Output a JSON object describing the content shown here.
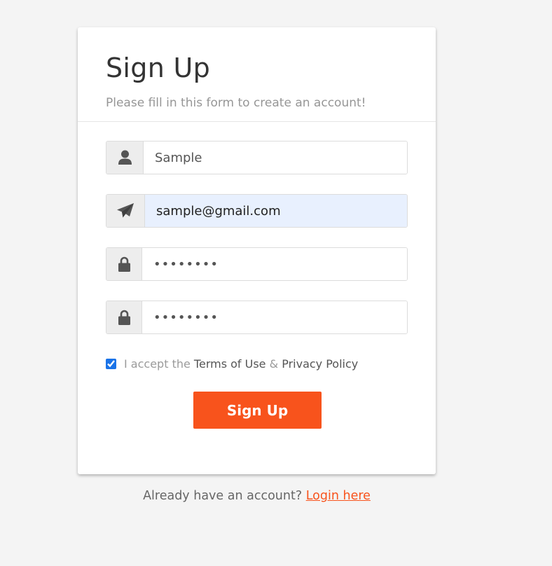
{
  "form": {
    "title": "Sign Up",
    "subtitle": "Please fill in this form to create an account!",
    "fields": {
      "username": {
        "value": "Sample",
        "icon": "user-icon"
      },
      "email": {
        "value": "sample@gmail.com",
        "icon": "paper-plane-icon"
      },
      "password": {
        "value": "sample12",
        "icon": "lock-icon"
      },
      "confirm_password": {
        "value": "sample12",
        "icon": "lock-icon"
      }
    },
    "accept": {
      "checked": true,
      "prefix": "I accept the",
      "terms_label": "Terms of Use",
      "ampersand": "&",
      "privacy_label": "Privacy Policy"
    },
    "submit_label": "Sign Up"
  },
  "footer": {
    "prompt": "Already have an account?",
    "login_label": "Login here"
  },
  "colors": {
    "accent": "#f8531c",
    "background": "#f4f4f4",
    "autofill": "#e8f0fe"
  }
}
